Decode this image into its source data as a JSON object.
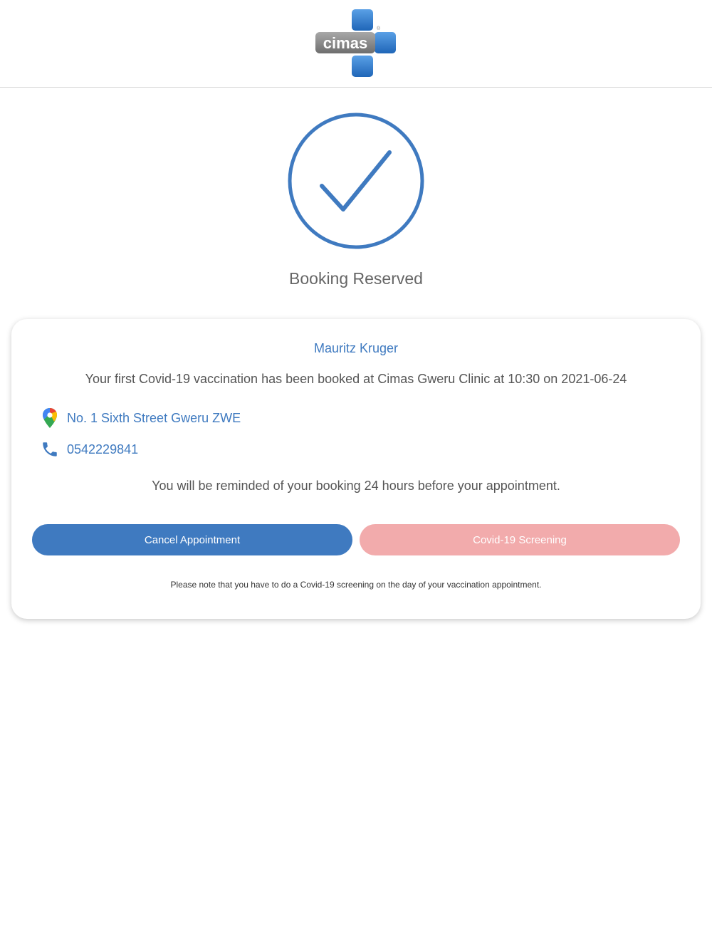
{
  "brand": {
    "logo_text": "cimas",
    "accent_color": "#3f7ac0",
    "secondary_button_color": "#f2abac"
  },
  "status": {
    "icon": "check-circle-icon",
    "title": "Booking Reserved"
  },
  "booking": {
    "patient_name": "Mauritz Kruger",
    "message": "Your first Covid-19 vaccination has been booked at Cimas Gweru Clinic at 10:30 on 2021-06-24",
    "address": "No. 1 Sixth Street Gweru ZWE",
    "phone": "0542229841",
    "reminder": "You will be reminded of your booking 24 hours before your appointment."
  },
  "actions": {
    "cancel_label": "Cancel Appointment",
    "screening_label": "Covid-19 Screening"
  },
  "note": "Please note that you have to do a Covid-19 screening on the day of your vaccination appointment."
}
